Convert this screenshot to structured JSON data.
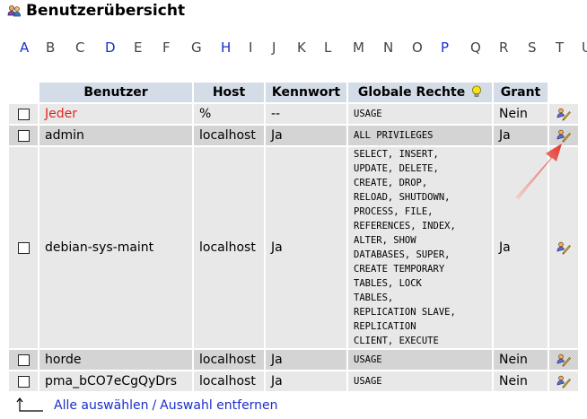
{
  "page": {
    "title": "Benutzerübersicht"
  },
  "alphabet": [
    {
      "letter": "A",
      "link": true
    },
    {
      "letter": "B",
      "link": false
    },
    {
      "letter": "C",
      "link": false
    },
    {
      "letter": "D",
      "link": true
    },
    {
      "letter": "E",
      "link": false
    },
    {
      "letter": "F",
      "link": false
    },
    {
      "letter": "G",
      "link": false
    },
    {
      "letter": "H",
      "link": true
    },
    {
      "letter": "I",
      "link": false
    },
    {
      "letter": "J",
      "link": false
    },
    {
      "letter": "K",
      "link": false
    },
    {
      "letter": "L",
      "link": false
    },
    {
      "letter": "M",
      "link": false
    },
    {
      "letter": "N",
      "link": false
    },
    {
      "letter": "O",
      "link": false
    },
    {
      "letter": "P",
      "link": true
    },
    {
      "letter": "Q",
      "link": false
    },
    {
      "letter": "R",
      "link": false
    },
    {
      "letter": "S",
      "link": false
    },
    {
      "letter": "T",
      "link": false
    },
    {
      "letter": "U",
      "link": false
    }
  ],
  "table": {
    "headers": {
      "user": "Benutzer",
      "host": "Host",
      "password": "Kennwort",
      "global_privileges": "Globale Rechte",
      "grant": "Grant"
    },
    "rows": [
      {
        "user": "Jeder",
        "host": "%",
        "password": "--",
        "privileges": [
          "USAGE"
        ],
        "grant": "Nein",
        "highlight": true
      },
      {
        "user": "admin",
        "host": "localhost",
        "password": "Ja",
        "privileges": [
          "ALL PRIVILEGES"
        ],
        "grant": "Ja",
        "highlight": false
      },
      {
        "user": "debian-sys-maint",
        "host": "localhost",
        "password": "Ja",
        "privileges": [
          "SELECT, INSERT,",
          "UPDATE, DELETE,",
          "CREATE, DROP,",
          "RELOAD, SHUTDOWN,",
          "PROCESS, FILE,",
          "REFERENCES, INDEX,",
          "ALTER, SHOW",
          "DATABASES, SUPER,",
          "CREATE TEMPORARY",
          "TABLES, LOCK",
          "TABLES,",
          "REPLICATION SLAVE,",
          "REPLICATION",
          "CLIENT, EXECUTE"
        ],
        "grant": "Ja",
        "highlight": false
      },
      {
        "user": "horde",
        "host": "localhost",
        "password": "Ja",
        "privileges": [
          "USAGE"
        ],
        "grant": "Nein",
        "highlight": false
      },
      {
        "user": "pma_bCO7eCgQyDrs",
        "host": "localhost",
        "password": "Ja",
        "privileges": [
          "USAGE"
        ],
        "grant": "Nein",
        "highlight": false
      }
    ]
  },
  "footer": {
    "select_all": "Alle auswählen",
    "separator": "/",
    "deselect_all": "Auswahl entfernen"
  },
  "colors": {
    "header_bg": "#d4dce7",
    "row_odd": "#e8e8e8",
    "row_even": "#d4d4d4",
    "link": "#1a2ec9",
    "highlight_user": "#e0261e",
    "annotation_arrow": "#e53024"
  },
  "icons": {
    "title": "users-icon",
    "privileges_hint": "lightbulb-icon",
    "edit": "edit-privileges-icon",
    "footer": "corner-arrow-icon"
  }
}
